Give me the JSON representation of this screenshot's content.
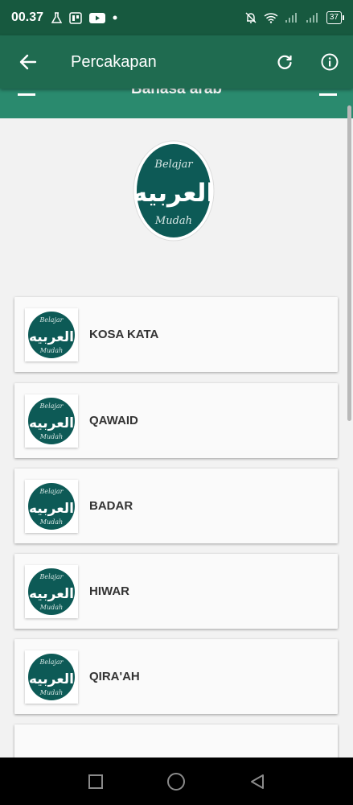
{
  "status_bar": {
    "time": "00.37",
    "battery": "37"
  },
  "app_bar": {
    "title": "Percakapan"
  },
  "web_header": {
    "title": "Bahasa arab"
  },
  "logo": {
    "top_text": "Belajar",
    "arabic_text": "العربيه",
    "bottom_text": "Mudah"
  },
  "menu": [
    {
      "label": "KOSA KATA"
    },
    {
      "label": "QAWAID"
    },
    {
      "label": "BADAR"
    },
    {
      "label": "HIWAR"
    },
    {
      "label": "QIRA'AH"
    }
  ],
  "colors": {
    "status_bar": "#17593f",
    "app_bar": "#1f6b50",
    "logo_circle": "#0d5a56"
  }
}
